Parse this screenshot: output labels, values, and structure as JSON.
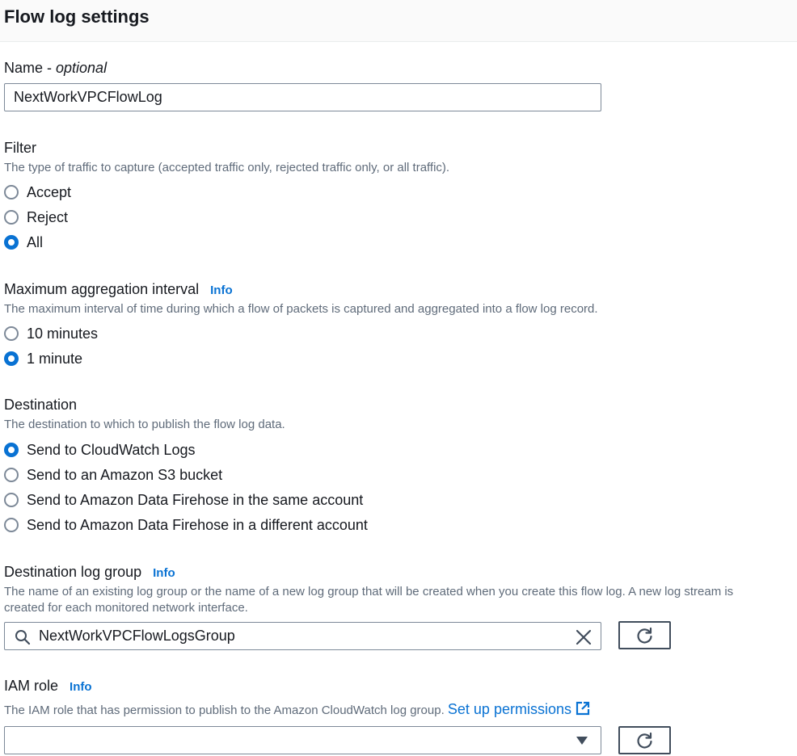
{
  "header": {
    "title": "Flow log settings"
  },
  "name_field": {
    "label": "Name - ",
    "optional": "optional",
    "value": "NextWorkVPCFlowLog"
  },
  "filter": {
    "label": "Filter",
    "description": "The type of traffic to capture (accepted traffic only, rejected traffic only, or all traffic).",
    "options": [
      {
        "label": "Accept",
        "checked": false
      },
      {
        "label": "Reject",
        "checked": false
      },
      {
        "label": "All",
        "checked": true
      }
    ]
  },
  "aggregation": {
    "label": "Maximum aggregation interval",
    "info": "Info",
    "description": "The maximum interval of time during which a flow of packets is captured and aggregated into a flow log record.",
    "options": [
      {
        "label": "10 minutes",
        "checked": false
      },
      {
        "label": "1 minute",
        "checked": true
      }
    ]
  },
  "destination": {
    "label": "Destination",
    "description": "The destination to which to publish the flow log data.",
    "options": [
      {
        "label": "Send to CloudWatch Logs",
        "checked": true
      },
      {
        "label": "Send to an Amazon S3 bucket",
        "checked": false
      },
      {
        "label": "Send to Amazon Data Firehose in the same account",
        "checked": false
      },
      {
        "label": "Send to Amazon Data Firehose in a different account",
        "checked": false
      }
    ]
  },
  "log_group": {
    "label": "Destination log group",
    "info": "Info",
    "description_line1": "The name of an existing log group or the name of a new log group that will be created when you create this flow log. A new log stream is",
    "description_line2": "created for each monitored network interface.",
    "value": "NextWorkVPCFlowLogsGroup",
    "icons": {
      "search": "search-icon",
      "clear": "close-icon",
      "refresh": "refresh-icon"
    }
  },
  "iam_role": {
    "label": "IAM role",
    "info": "Info",
    "description": "The IAM role that has permission to publish to the Amazon CloudWatch log group.",
    "link": "Set up permissions",
    "value": "",
    "icons": {
      "dropdown": "caret-down-icon",
      "refresh": "refresh-icon",
      "external": "external-link-icon"
    }
  },
  "colors": {
    "accent": "#0972d3",
    "text": "#16191f",
    "muted": "#5f6b7a",
    "border": "#7d8998",
    "header_bg": "#fafafa"
  }
}
